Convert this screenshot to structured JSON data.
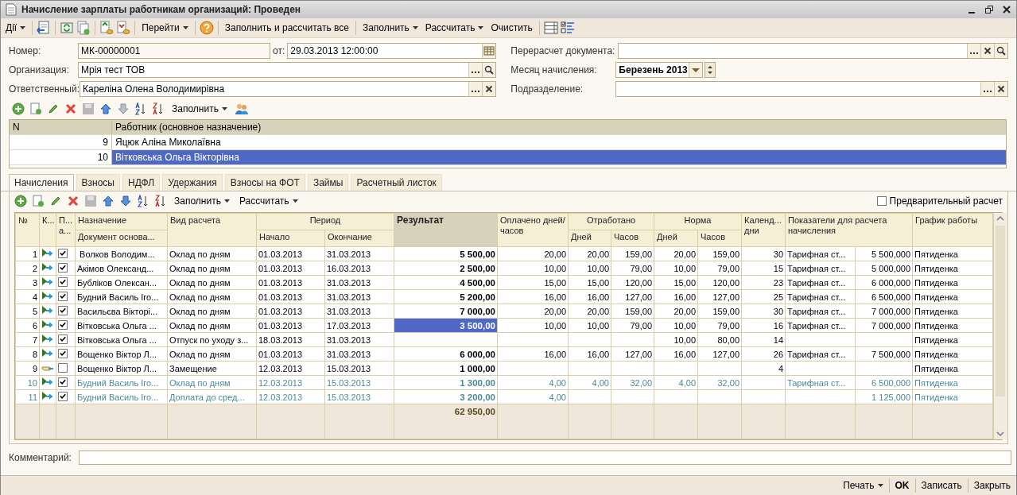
{
  "window": {
    "title": "Начисление зарплаты работникам организаций: Проведен"
  },
  "toolbar": [
    {
      "label": "Дії",
      "dropdown": true
    },
    {
      "label": "Перейти",
      "dropdown": true
    },
    {
      "label": "Заполнить и рассчитать все",
      "dropdown": false
    },
    {
      "label": "Заполнить",
      "dropdown": true
    },
    {
      "label": "Рассчитать",
      "dropdown": true
    },
    {
      "label": "Очистить",
      "dropdown": false
    }
  ],
  "form": {
    "number": {
      "label": "Номер:",
      "value": "МК-00000001"
    },
    "date": {
      "label": "от:",
      "value": "29.03.2013 12:00:00"
    },
    "organization": {
      "label": "Организация:",
      "value": "Мрія тест ТОВ"
    },
    "responsible": {
      "label": "Ответственный:",
      "value": "Кареліна Олена Володимирівна"
    },
    "recalc": {
      "label": "Перерасчет документа:"
    },
    "month": {
      "label": "Месяц начисления:",
      "value": "Березень 2013"
    },
    "department": {
      "label": "Подразделение:"
    }
  },
  "employees": {
    "fill_button": {
      "label": "Заполнить",
      "dropdown": true
    },
    "columns": [
      "N",
      "Работник (основное назначение)"
    ],
    "rows": [
      {
        "n": "9",
        "name": "Яцюк Аліна Миколаївна",
        "selected": false
      },
      {
        "n": "10",
        "name": "Вітковська Ольга Вікторівна",
        "selected": true
      }
    ]
  },
  "tabs": [
    {
      "label": "Начисления",
      "selected": true
    },
    {
      "label": "Взносы",
      "selected": false
    },
    {
      "label": "НДФЛ",
      "selected": false
    },
    {
      "label": "Удержания",
      "selected": false
    },
    {
      "label": "Взносы на ФОТ",
      "selected": false
    },
    {
      "label": "Займы",
      "selected": false
    },
    {
      "label": "Расчетный листок",
      "selected": false
    }
  ],
  "grid_toolbar": {
    "buttons": [
      {
        "label": "Заполнить",
        "dropdown": true
      },
      {
        "label": "Рассчитать",
        "dropdown": true
      }
    ],
    "preliminary": {
      "label": "Предварительный расчет",
      "checked": false
    }
  },
  "grid": {
    "headers": {
      "num": "№",
      "k": "К...",
      "p": "П... а...",
      "assignment": "Назначение",
      "basis_doc": "Документ основа...",
      "calc_type": "Вид расчета",
      "period": "Период",
      "start": "Начало",
      "end": "Окончание",
      "result": "Результат",
      "paid": "Оплачено дней/часов",
      "worked": "Отработано",
      "worked_days": "Дней",
      "worked_hours": "Часов",
      "norm": "Норма",
      "norm_days": "Дней",
      "norm_hours": "Часов",
      "cal_days": "Календ... дни",
      "indicators": "Показатели для расчета начисления",
      "schedule": "График работы"
    },
    "rows": [
      {
        "num": "1",
        "kind": "accrual",
        "checked": true,
        "greyed": false,
        "selected": false,
        "assignment": " Волков Володим...",
        "calc_type": "Оклад по дням",
        "start": "01.03.2013",
        "end": "31.03.2013",
        "result": "5 500,00",
        "paid": "20,00",
        "worked_days": "20,00",
        "worked_hours": "159,00",
        "norm_days": "20,00",
        "norm_hours": "159,00",
        "cal_days": "30",
        "ind_name": "Тарифная ст...",
        "ind_value": "5 500,000",
        "schedule": "Пятиденка"
      },
      {
        "num": "2",
        "kind": "accrual",
        "checked": true,
        "greyed": false,
        "selected": false,
        "assignment": "Акімов Олександ...",
        "calc_type": "Оклад по дням",
        "start": "01.03.2013",
        "end": "16.03.2013",
        "result": "2 500,00",
        "paid": "10,00",
        "worked_days": "10,00",
        "worked_hours": "79,00",
        "norm_days": "10,00",
        "norm_hours": "79,00",
        "cal_days": "15",
        "ind_name": "Тарифная ст...",
        "ind_value": "5 000,000",
        "schedule": "Пятиденка"
      },
      {
        "num": "3",
        "kind": "accrual",
        "checked": true,
        "greyed": false,
        "selected": false,
        "assignment": "Бубліков Олексан...",
        "calc_type": "Оклад по дням",
        "start": "01.03.2013",
        "end": "31.03.2013",
        "result": "4 500,00",
        "paid": "15,00",
        "worked_days": "15,00",
        "worked_hours": "120,00",
        "norm_days": "15,00",
        "norm_hours": "120,00",
        "cal_days": "23",
        "ind_name": "Тарифная ст...",
        "ind_value": "6 000,000",
        "schedule": "Пятиденка"
      },
      {
        "num": "4",
        "kind": "accrual",
        "checked": true,
        "greyed": false,
        "selected": false,
        "assignment": "Будний Василь Іго...",
        "calc_type": "Оклад по дням",
        "start": "01.03.2013",
        "end": "31.03.2013",
        "result": "5 200,00",
        "paid": "16,00",
        "worked_days": "16,00",
        "worked_hours": "127,00",
        "norm_days": "16,00",
        "norm_hours": "127,00",
        "cal_days": "25",
        "ind_name": "Тарифная ст...",
        "ind_value": "6 500,000",
        "schedule": "Пятиденка"
      },
      {
        "num": "5",
        "kind": "accrual",
        "checked": true,
        "greyed": false,
        "selected": false,
        "assignment": "Васильєва Вікторі...",
        "calc_type": "Оклад по дням",
        "start": "01.03.2013",
        "end": "31.03.2013",
        "result": "7 000,00",
        "paid": "20,00",
        "worked_days": "20,00",
        "worked_hours": "159,00",
        "norm_days": "20,00",
        "norm_hours": "159,00",
        "cal_days": "30",
        "ind_name": "Тарифная ст...",
        "ind_value": "7 000,000",
        "schedule": "Пятиденка"
      },
      {
        "num": "6",
        "kind": "accrual",
        "checked": true,
        "greyed": false,
        "selected": true,
        "assignment": "Вітковська Ольга ...",
        "calc_type": "Оклад по дням",
        "start": "01.03.2013",
        "end": "17.03.2013",
        "result": "3 500,00",
        "paid": "10,00",
        "worked_days": "10,00",
        "worked_hours": "79,00",
        "norm_days": "10,00",
        "norm_hours": "79,00",
        "cal_days": "16",
        "ind_name": "Тарифная ст...",
        "ind_value": "7 000,000",
        "schedule": "Пятиденка"
      },
      {
        "num": "7",
        "kind": "accrual",
        "checked": true,
        "greyed": false,
        "selected": false,
        "assignment": "Вітковська Ольга ...",
        "calc_type": "Отпуск по уходу з...",
        "start": "18.03.2013",
        "end": "31.03.2013",
        "norm_days": "10,00",
        "norm_hours": "80,00",
        "cal_days": "14",
        "schedule": "Пятиденка"
      },
      {
        "num": "8",
        "kind": "accrual",
        "checked": true,
        "greyed": false,
        "selected": false,
        "assignment": "Вощенко Віктор Л...",
        "calc_type": "Оклад по дням",
        "start": "01.03.2013",
        "end": "31.03.2013",
        "result": "6 000,00",
        "paid": "16,00",
        "worked_days": "16,00",
        "worked_hours": "127,00",
        "norm_days": "16,00",
        "norm_hours": "127,00",
        "cal_days": "26",
        "ind_name": "Тарифная ст...",
        "ind_value": "7 500,000",
        "schedule": "Пятиденка"
      },
      {
        "num": "9",
        "kind": "substitution",
        "checked": false,
        "greyed": false,
        "selected": false,
        "assignment": "Вощенко Віктор Л...",
        "calc_type": "Замещение",
        "start": "12.03.2013",
        "end": "15.03.2013",
        "result": "1 000,00",
        "cal_days": "4",
        "schedule": "Пятиденка"
      },
      {
        "num": "10",
        "kind": "accrual",
        "checked": true,
        "greyed": true,
        "selected": false,
        "assignment": "Будний Василь Іго...",
        "calc_type": "Оклад по дням",
        "start": "12.03.2013",
        "end": "15.03.2013",
        "result": "1 300,00",
        "paid": "4,00",
        "worked_days": "4,00",
        "worked_hours": "32,00",
        "norm_days": "4,00",
        "norm_hours": "32,00",
        "ind_name": "Тарифная ст...",
        "ind_value": "6 500,000",
        "schedule": "Пятиденка"
      },
      {
        "num": "11",
        "kind": "accrual",
        "checked": true,
        "greyed": true,
        "selected": false,
        "assignment": "Будний Василь Іго...",
        "calc_type": "Доплата до сред...",
        "start": "12.03.2013",
        "end": "15.03.2013",
        "result": "3 200,00",
        "paid": "4,00",
        "ind_value": "1 125,000",
        "schedule": "Пятиденка"
      }
    ],
    "total": "62 950,00"
  },
  "comment": {
    "label": "Комментарий:"
  },
  "footer_buttons": [
    {
      "label": "Печать",
      "dropdown": true,
      "default": false
    },
    {
      "label": "OK",
      "dropdown": false,
      "default": true
    },
    {
      "label": "Записать",
      "dropdown": false,
      "default": false
    },
    {
      "label": "Закрыть",
      "dropdown": false,
      "default": false
    }
  ]
}
